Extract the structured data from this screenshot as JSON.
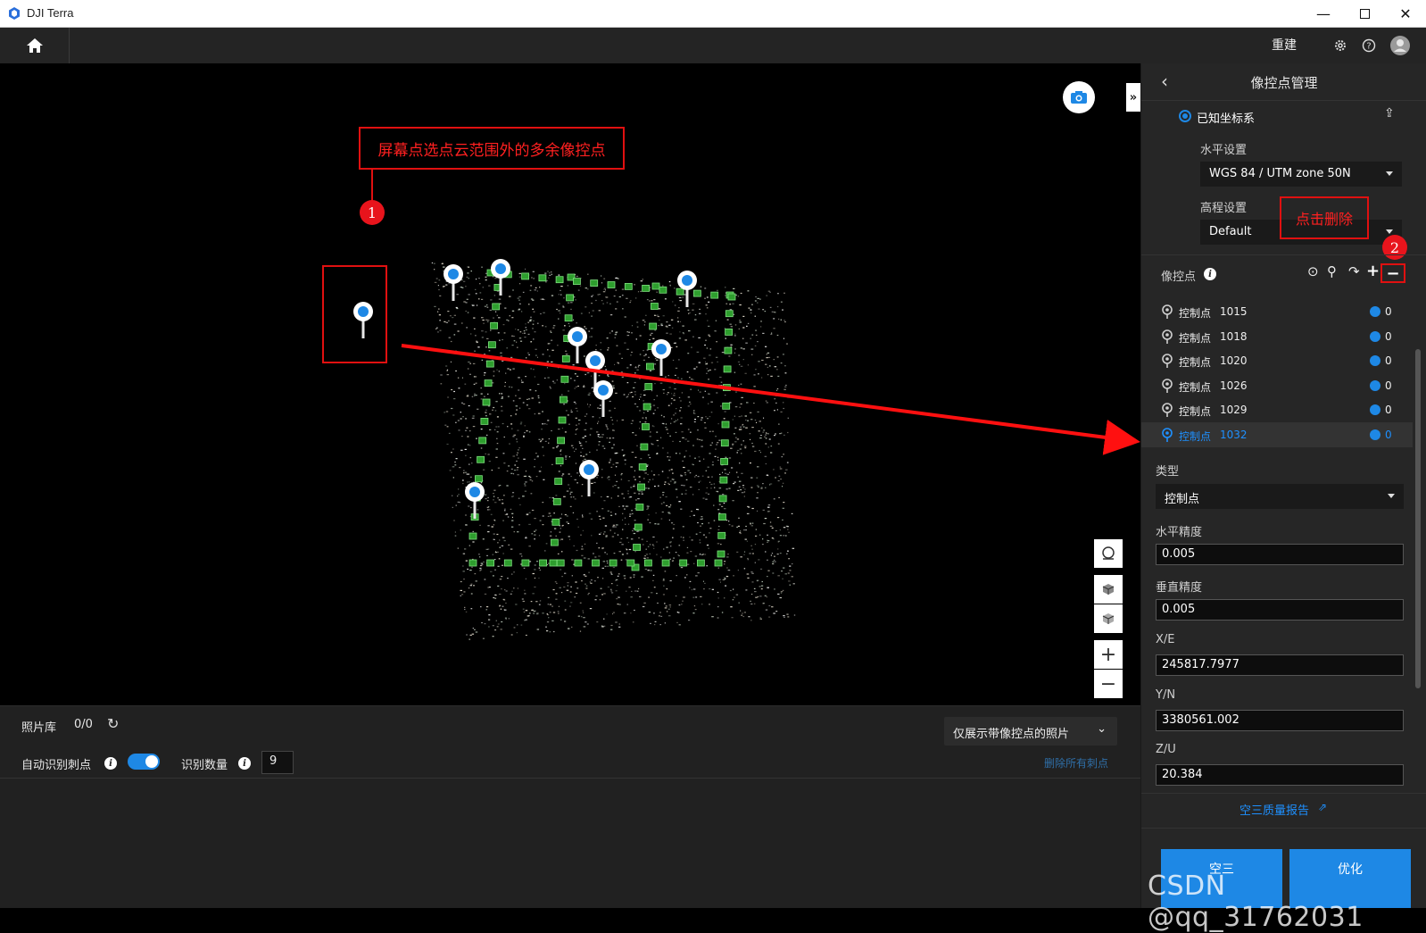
{
  "window": {
    "title": "DJI Terra"
  },
  "toolbar": {
    "rebuild_label": "重建"
  },
  "annotations": {
    "note1": "屏幕点选点云范围外的多余像控点",
    "note2": "点击删除",
    "badge1": "1",
    "badge2": "2"
  },
  "panel": {
    "title": "像控点管理",
    "coord_system_label": "已知坐标系",
    "horizontal_label": "水平设置",
    "horizontal_value": "WGS 84 / UTM zone 50N",
    "elevation_label": "高程设置",
    "elevation_value": "Default",
    "gcp_section_label": "像控点",
    "gcp_rows": [
      {
        "name": "控制点",
        "id": "1015",
        "count": "0"
      },
      {
        "name": "控制点",
        "id": "1018",
        "count": "0"
      },
      {
        "name": "控制点",
        "id": "1020",
        "count": "0"
      },
      {
        "name": "控制点",
        "id": "1026",
        "count": "0"
      },
      {
        "name": "控制点",
        "id": "1029",
        "count": "0"
      },
      {
        "name": "控制点",
        "id": "1032",
        "count": "0"
      }
    ],
    "type_label": "类型",
    "type_value": "控制点",
    "h_precision_label": "水平精度",
    "h_precision_value": "0.005",
    "v_precision_label": "垂直精度",
    "v_precision_value": "0.005",
    "x_label": "X/E",
    "x_value": "245817.7977",
    "y_label": "Y/N",
    "y_value": "3380561.002",
    "z_label": "Z/U",
    "z_value": "20.384",
    "report_link": "空三质量报告",
    "btn_left": "空三",
    "btn_right": "优化"
  },
  "bottom": {
    "photo_library_label": "照片库",
    "photo_count": "0/0",
    "filter_label": "仅展示带像控点的照片",
    "auto_detect_label": "自动识别刺点",
    "detect_count_label": "识别数量",
    "detect_count_value": "9",
    "delete_all_label": "删除所有刺点"
  },
  "watermark": "CSDN @qq_31762031",
  "colors": {
    "accent": "#1e88e5",
    "annotation": "#e01010",
    "panel_bg": "#262626"
  }
}
